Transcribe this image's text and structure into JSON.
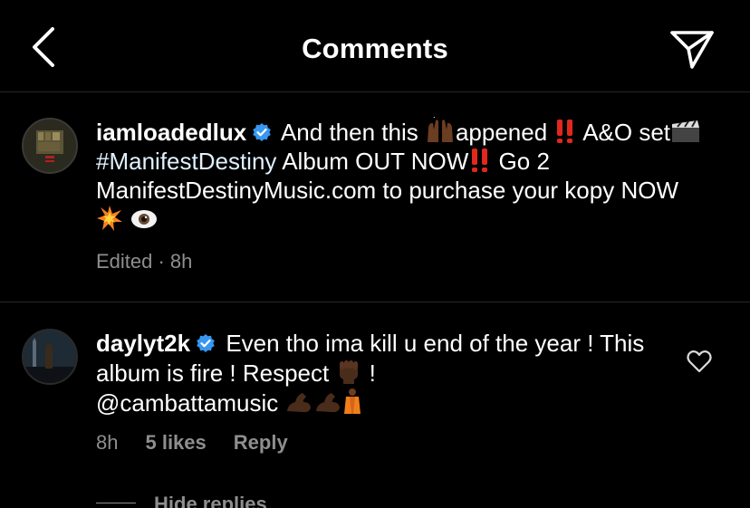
{
  "header": {
    "title": "Comments",
    "back_icon": "chevron-left-icon",
    "share_icon": "paper-plane-icon"
  },
  "comments": [
    {
      "username": "iamloadedlux",
      "verified": true,
      "text_a": "And then this ",
      "text_b": "appened ",
      "text_c": " A&O set",
      "hashtag": "#ManifestDestiny",
      "text_d": " Album OUT NOW",
      "text_e": " Go 2 ManifestDestinyMusic.com to purchase your kopy NOW",
      "meta_edited": "Edited · 8h"
    },
    {
      "username": "daylyt2k",
      "verified": true,
      "text_a": "Even tho ima kill u end of the year ! This album is fire ! Respect ",
      "text_b": " !",
      "mention": "@cambattamusic",
      "meta_time": "8h",
      "meta_likes": "5 likes",
      "meta_reply": "Reply",
      "hide_replies": "Hide replies"
    }
  ],
  "colors": {
    "background": "#000000",
    "text": "#ffffff",
    "secondary": "#8e8e8e",
    "divider": "#262626",
    "verified": "#3897f0"
  }
}
